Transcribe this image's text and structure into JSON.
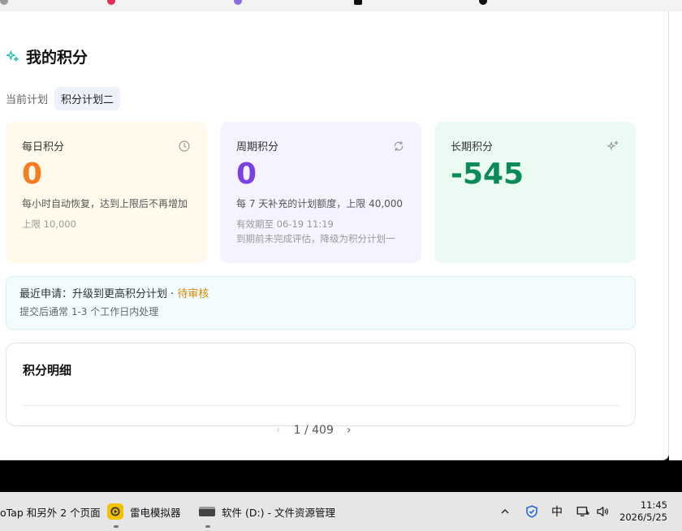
{
  "page": {
    "title": "我的积分",
    "current_plan_label": "当前计划",
    "current_plan_value": "积分计划二"
  },
  "cards": {
    "daily": {
      "name": "每日积分",
      "value": "0",
      "desc": "每小时自动恢复，达到上限后不再增加",
      "limit": "上限 10,000"
    },
    "period": {
      "name": "周期积分",
      "value": "0",
      "desc": "每 7 天补充的计划额度，上限 40,000",
      "expiry": "有效期至 06-19 11:19",
      "note": "到期前未完成评估，降级为积分计划一"
    },
    "long": {
      "name": "长期积分",
      "value": "-545"
    }
  },
  "notice": {
    "prefix": "最近申请：升级到更高积分计划 · ",
    "status": "待审核",
    "detail": "提交后通常 1-3 个工作日内处理"
  },
  "detail": {
    "title": "积分明细"
  },
  "pager": {
    "prev": "‹",
    "text": "1 / 409",
    "next": "›"
  },
  "taskbar": {
    "item1": "oTap 和另外 2 个页面",
    "item2": "雷电模拟器",
    "item3": "软件 (D:) - 文件资源管理",
    "ime": "中",
    "time": "11:45",
    "date": "2026/5/25"
  },
  "colors": {
    "daily_accent": "#f57c1f",
    "period_accent": "#7b3fe4",
    "long_accent": "#0b8a5a",
    "pending": "#d48806"
  }
}
